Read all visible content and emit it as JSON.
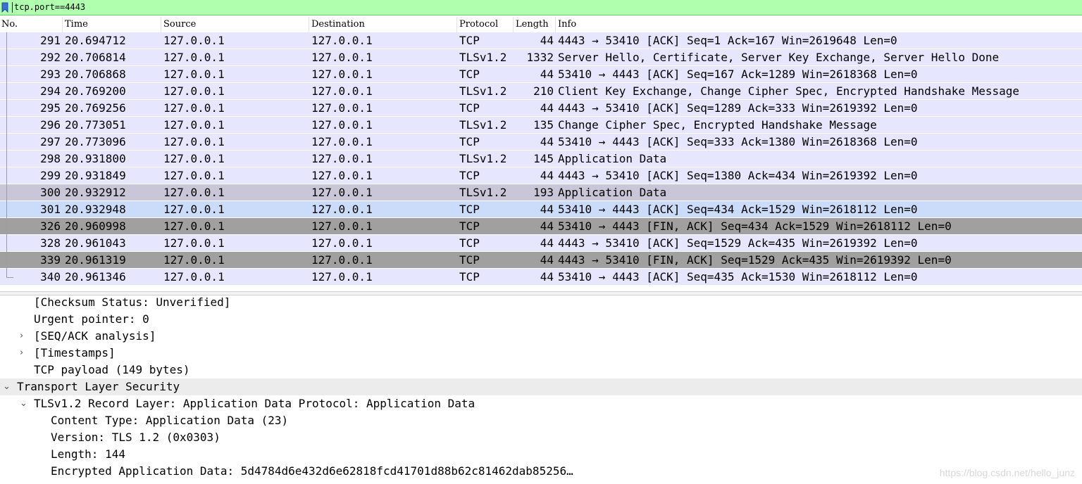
{
  "filter": {
    "value": "tcp.port==4443"
  },
  "columns": [
    "No.",
    "Time",
    "Source",
    "Destination",
    "Protocol",
    "Length",
    "Info"
  ],
  "packets": [
    {
      "no": "291",
      "time": "20.694712",
      "src": "127.0.0.1",
      "dst": "127.0.0.1",
      "proto": "TCP",
      "len": "44",
      "info": "4443 → 53410 [ACK] Seq=1 Ack=167 Win=2619648 Len=0"
    },
    {
      "no": "292",
      "time": "20.706814",
      "src": "127.0.0.1",
      "dst": "127.0.0.1",
      "proto": "TLSv1.2",
      "len": "1332",
      "info": "Server Hello, Certificate, Server Key Exchange, Server Hello Done"
    },
    {
      "no": "293",
      "time": "20.706868",
      "src": "127.0.0.1",
      "dst": "127.0.0.1",
      "proto": "TCP",
      "len": "44",
      "info": "53410 → 4443 [ACK] Seq=167 Ack=1289 Win=2618368 Len=0"
    },
    {
      "no": "294",
      "time": "20.769200",
      "src": "127.0.0.1",
      "dst": "127.0.0.1",
      "proto": "TLSv1.2",
      "len": "210",
      "info": "Client Key Exchange, Change Cipher Spec, Encrypted Handshake Message"
    },
    {
      "no": "295",
      "time": "20.769256",
      "src": "127.0.0.1",
      "dst": "127.0.0.1",
      "proto": "TCP",
      "len": "44",
      "info": "4443 → 53410 [ACK] Seq=1289 Ack=333 Win=2619392 Len=0"
    },
    {
      "no": "296",
      "time": "20.773051",
      "src": "127.0.0.1",
      "dst": "127.0.0.1",
      "proto": "TLSv1.2",
      "len": "135",
      "info": "Change Cipher Spec, Encrypted Handshake Message"
    },
    {
      "no": "297",
      "time": "20.773096",
      "src": "127.0.0.1",
      "dst": "127.0.0.1",
      "proto": "TCP",
      "len": "44",
      "info": "53410 → 4443 [ACK] Seq=333 Ack=1380 Win=2618368 Len=0"
    },
    {
      "no": "298",
      "time": "20.931800",
      "src": "127.0.0.1",
      "dst": "127.0.0.1",
      "proto": "TLSv1.2",
      "len": "145",
      "info": "Application Data"
    },
    {
      "no": "299",
      "time": "20.931849",
      "src": "127.0.0.1",
      "dst": "127.0.0.1",
      "proto": "TCP",
      "len": "44",
      "info": "4443 → 53410 [ACK] Seq=1380 Ack=434 Win=2619392 Len=0"
    },
    {
      "no": "300",
      "time": "20.932912",
      "src": "127.0.0.1",
      "dst": "127.0.0.1",
      "proto": "TLSv1.2",
      "len": "193",
      "info": "Application Data"
    },
    {
      "no": "301",
      "time": "20.932948",
      "src": "127.0.0.1",
      "dst": "127.0.0.1",
      "proto": "TCP",
      "len": "44",
      "info": "53410 → 4443 [ACK] Seq=434 Ack=1529 Win=2618112 Len=0"
    },
    {
      "no": "326",
      "time": "20.960998",
      "src": "127.0.0.1",
      "dst": "127.0.0.1",
      "proto": "TCP",
      "len": "44",
      "info": "53410 → 4443 [FIN, ACK] Seq=434 Ack=1529 Win=2618112 Len=0"
    },
    {
      "no": "328",
      "time": "20.961043",
      "src": "127.0.0.1",
      "dst": "127.0.0.1",
      "proto": "TCP",
      "len": "44",
      "info": "4443 → 53410 [ACK] Seq=1529 Ack=435 Win=2619392 Len=0"
    },
    {
      "no": "339",
      "time": "20.961319",
      "src": "127.0.0.1",
      "dst": "127.0.0.1",
      "proto": "TCP",
      "len": "44",
      "info": "4443 → 53410 [FIN, ACK] Seq=1529 Ack=435 Win=2619392 Len=0"
    },
    {
      "no": "340",
      "time": "20.961346",
      "src": "127.0.0.1",
      "dst": "127.0.0.1",
      "proto": "TCP",
      "len": "44",
      "info": "53410 → 4443 [ACK] Seq=435 Ack=1530 Win=2618112 Len=0"
    }
  ],
  "details": [
    {
      "text": "[Checksum Status: Unverified]"
    },
    {
      "text": "Urgent pointer: 0"
    },
    {
      "text": "[SEQ/ACK analysis]"
    },
    {
      "text": "[Timestamps]"
    },
    {
      "text": "TCP payload (149 bytes)"
    },
    {
      "text": "Transport Layer Security"
    },
    {
      "text": "TLSv1.2 Record Layer: Application Data Protocol: Application Data"
    },
    {
      "text": "Content Type: Application Data (23)"
    },
    {
      "text": "Version: TLS 1.2 (0x0303)"
    },
    {
      "text": "Length: 144"
    },
    {
      "text": "Encrypted Application Data: 5d4784d6e432d6e62818fcd41701d88b62c81462dab85256…"
    }
  ],
  "watermark": "https://blog.csdn.net/hello_junz",
  "colors": {
    "filter_bg": "#afffaf",
    "row_bg": "#e7e6ff",
    "row_selected": "#c8c6d7",
    "row_related": "#cbdcfb",
    "row_fin": "#a0a0a0"
  }
}
